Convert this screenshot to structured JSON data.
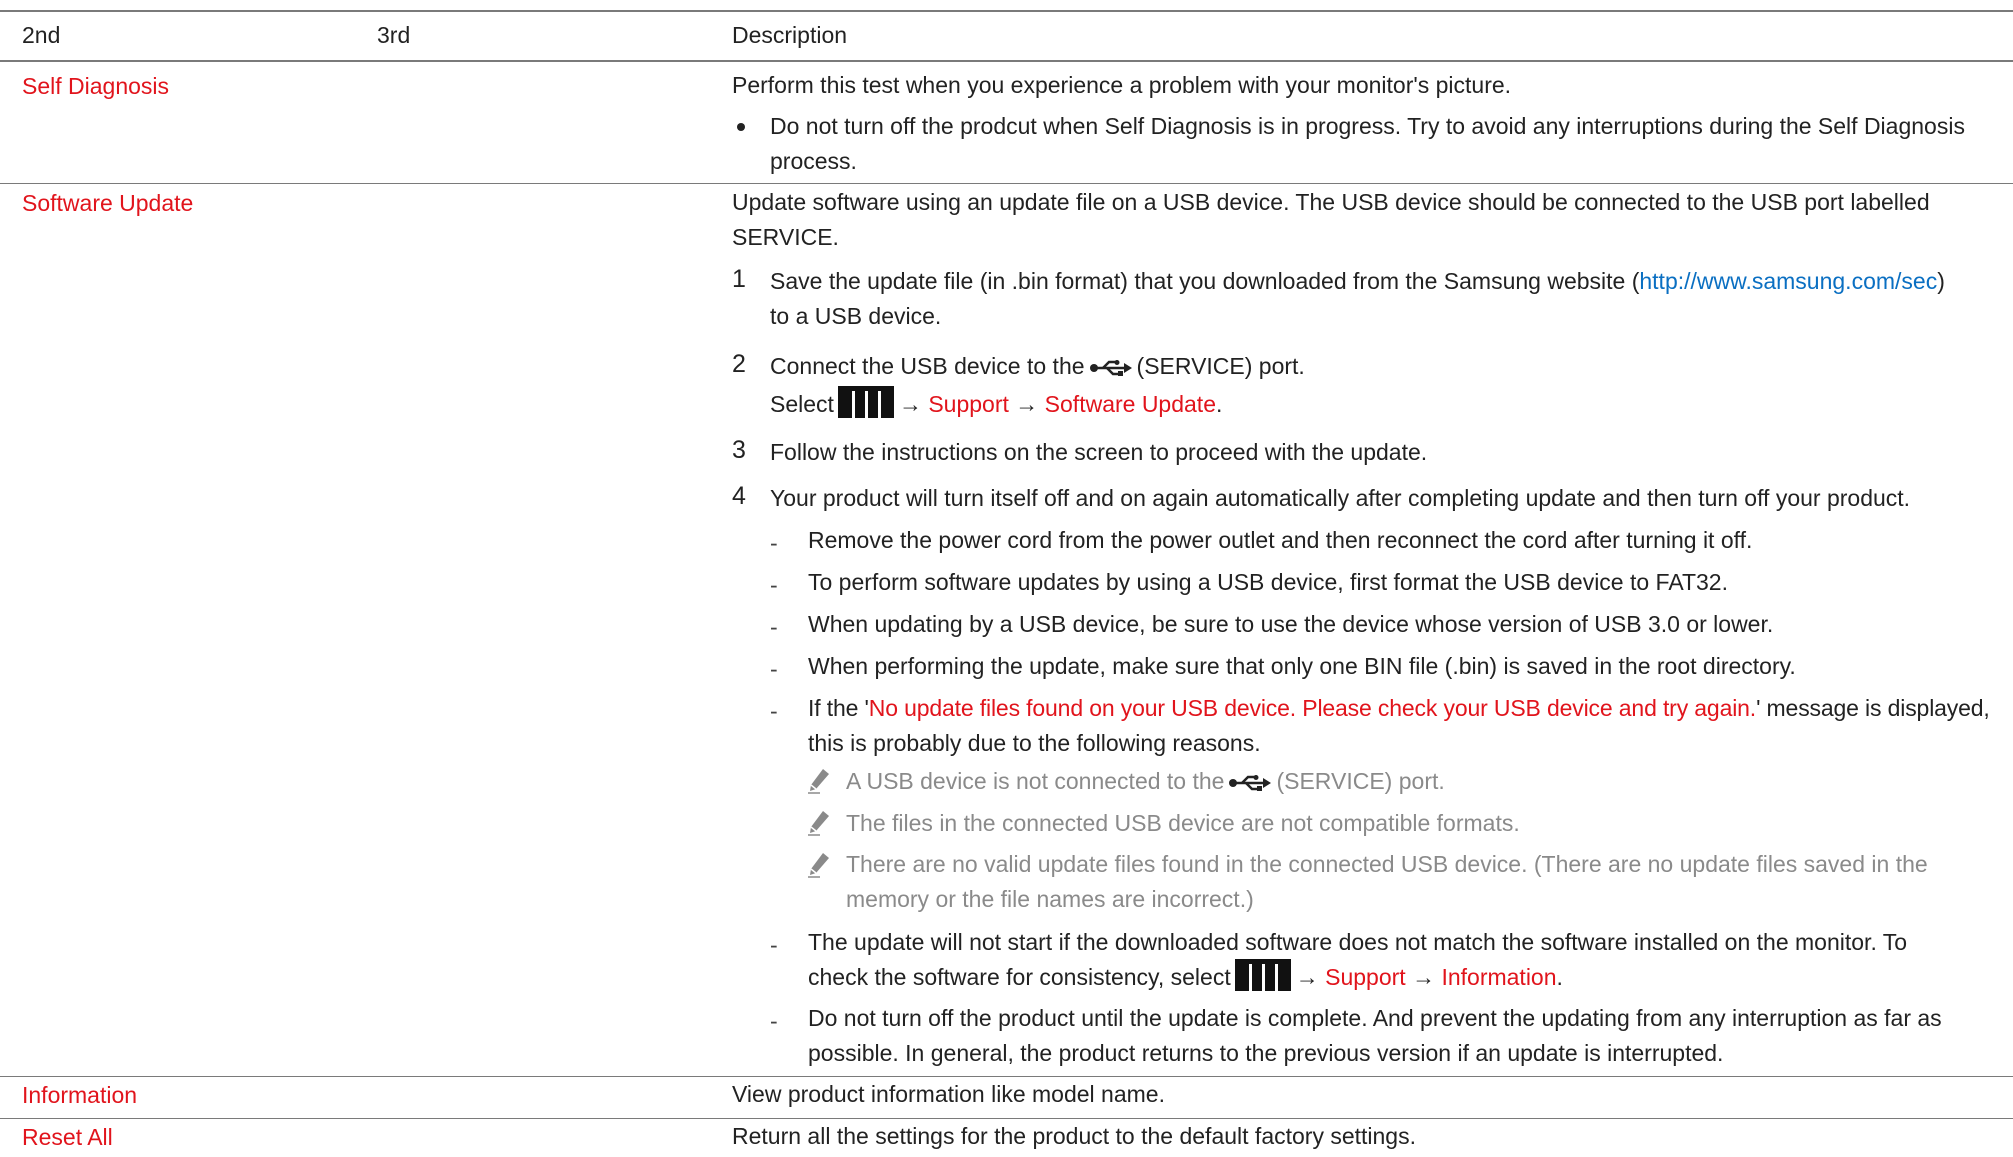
{
  "header": {
    "col2": "2nd",
    "col3": "3rd",
    "col_desc": "Description"
  },
  "rows": {
    "self_diagnosis": {
      "label": "Self Diagnosis",
      "desc": "Perform this test when you experience a problem with your monitor's picture.",
      "bullet_line1": "Do not turn off the prodcut when Self Diagnosis is in progress. Try to avoid any interruptions during the Self Diagnosis",
      "bullet_line2": "process."
    },
    "software_update": {
      "label": "Software Update",
      "desc_line1": "Update software using an update file on a USB device. The USB device should be connected to the USB port labelled",
      "desc_line2": "SERVICE.",
      "step1": {
        "num": "1",
        "pre": "Save the update file (in .bin format) that you downloaded from the Samsung website (",
        "link": "http://www.samsung.com/sec",
        "post": ")",
        "line2": "to a USB device."
      },
      "step2": {
        "num": "2",
        "pre": "Connect the USB device to the",
        "post": "(SERVICE) port.",
        "select": "Select",
        "arrow": "→",
        "support": "Support",
        "software_update": "Software Update",
        "period": "."
      },
      "step3": {
        "num": "3",
        "text": "Follow the instructions on the screen to proceed with the update."
      },
      "step4": {
        "num": "4",
        "text": "Your product will turn itself off and on again automatically after completing update and then turn off your product."
      },
      "dash": "-",
      "notes": {
        "n1": "Remove the power cord from the power outlet and then reconnect the cord after turning it off.",
        "n2": "To perform software updates by using a USB device, first format the USB device to FAT32.",
        "n3": "When updating by a USB device, be sure to use the device whose version of USB 3.0 or lower.",
        "n4": "When performing the update, make sure that only one BIN file (.bin) is saved in the root directory.",
        "n5_pre": "If the '",
        "n5_msg": "No update files found on your USB device. Please check your USB device and try again.",
        "n5_post": "' message is displayed,",
        "n5_line2": "this is probably due to the following reasons.",
        "n6_line1": "The update will not start if the downloaded software does not match the software installed on the monitor. To",
        "n6_pre": "check the software for consistency, select",
        "n6_arrow": "→",
        "n6_support": "Support",
        "n6_information": "Information",
        "n6_period": ".",
        "n7_line1": "Do not turn off the product until the update is complete. And prevent the updating from any interruption as far as",
        "n7_line2": "possible. In general, the product returns to the previous version if an update is interrupted."
      },
      "reasons": {
        "r1_pre": "A USB device is not connected to the",
        "r1_post": "(SERVICE) port.",
        "r2": "The files in the connected USB device are not compatible formats.",
        "r3_line1": "There are no valid update files found in the connected USB device. (There are no update files saved in the",
        "r3_line2": "memory or the file names are incorrect.)"
      }
    },
    "information": {
      "label": "Information",
      "desc": "View product information like model name."
    },
    "reset_all": {
      "label": "Reset All",
      "desc": "Return all the settings for the product to the default factory settings."
    }
  },
  "colors": {
    "accent_red": "#e1141c",
    "link_blue": "#0a6fc2",
    "note_grey": "#8a8a8a",
    "rule_grey": "#7a7a7a"
  },
  "icons": [
    "bullet-icon",
    "usb-port-icon",
    "menu-icon",
    "pencil-note-icon"
  ]
}
